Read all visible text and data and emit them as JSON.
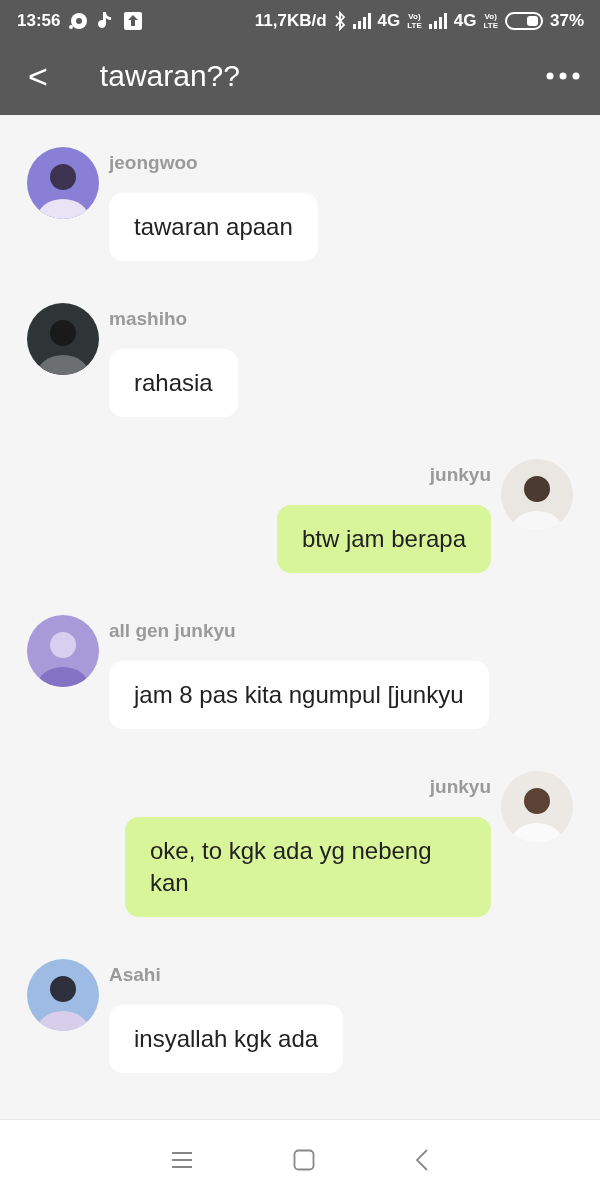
{
  "status_bar": {
    "time": "13:56",
    "speed": "11,7KB/d",
    "network_1": "4G",
    "volte_1": [
      "Vo)",
      "LTE"
    ],
    "network_2": "4G",
    "volte_2": [
      "Vo)",
      "LTE"
    ],
    "battery": "37%"
  },
  "header": {
    "back": "<",
    "title": "tawaran??"
  },
  "messages": [
    {
      "kind": "incoming",
      "sender": "jeongwoo",
      "lines": "tawaran apaan"
    },
    {
      "kind": "incoming",
      "sender": "mashiho",
      "lines": "rahasia"
    },
    {
      "kind": "outgoing",
      "sender": "junkyu",
      "lines": "btw jam berapa"
    },
    {
      "kind": "incoming",
      "sender": "all gen junkyu",
      "lines": "jam 8 pas kita ngumpul [junkyu"
    },
    {
      "kind": "outgoing",
      "sender": "junkyu",
      "lines": "oke, to kgk ada yg nebeng kan"
    },
    {
      "kind": "incoming",
      "sender": "Asahi",
      "lines": "insyallah kgk ada"
    }
  ]
}
